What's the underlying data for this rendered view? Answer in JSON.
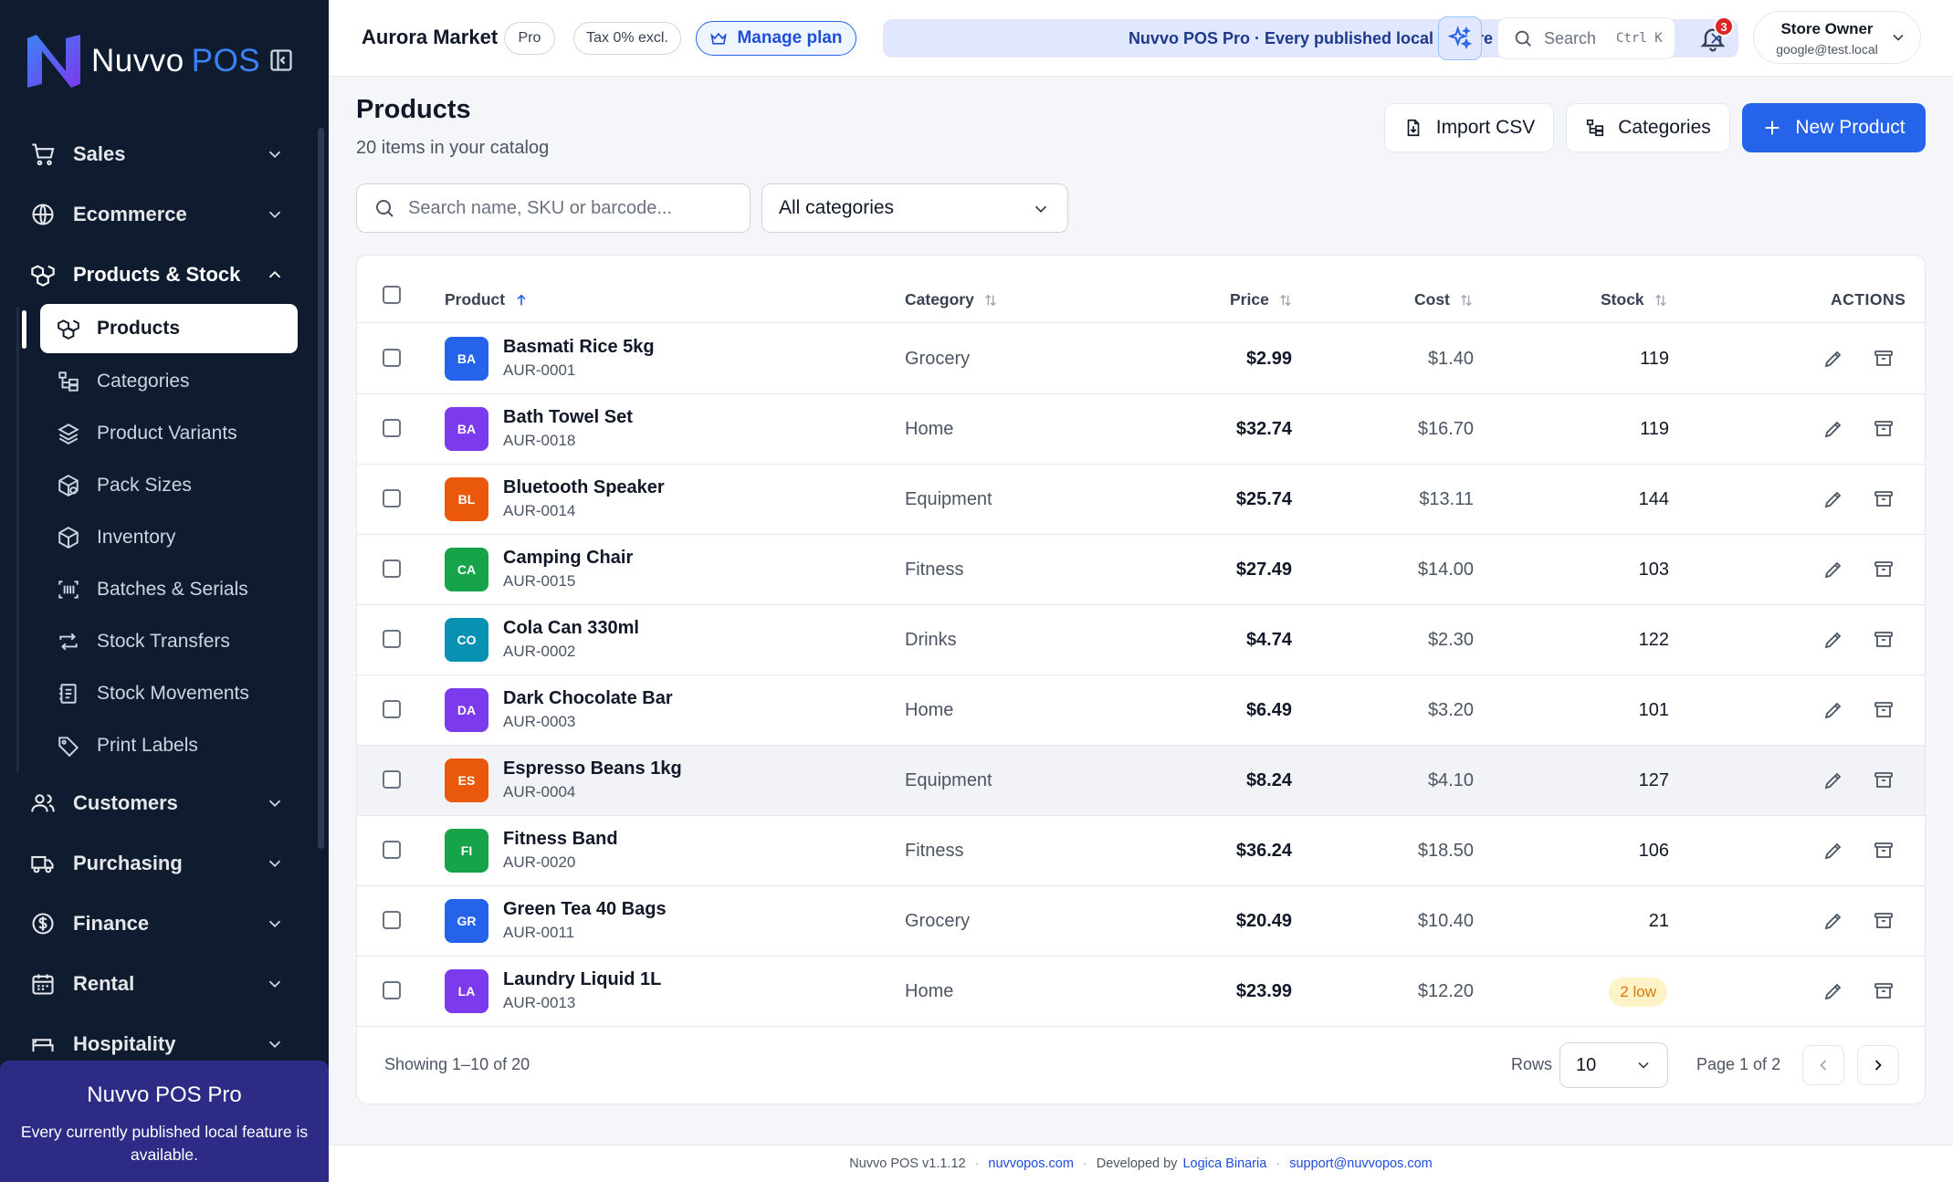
{
  "brand": {
    "name": "Nuvvo",
    "suffix": "POS"
  },
  "sidebar": {
    "groups": [
      {
        "label": "Sales",
        "icon": "cart-icon"
      },
      {
        "label": "Ecommerce",
        "icon": "globe-icon"
      },
      {
        "label": "Products & Stock",
        "icon": "boxes-icon",
        "expanded": true
      },
      {
        "label": "Customers",
        "icon": "users-icon"
      },
      {
        "label": "Purchasing",
        "icon": "truck-icon"
      },
      {
        "label": "Finance",
        "icon": "dollar-circle-icon"
      },
      {
        "label": "Rental",
        "icon": "calendar-icon"
      },
      {
        "label": "Hospitality",
        "icon": "bed-icon"
      }
    ],
    "sub_items": [
      {
        "label": "Products",
        "icon": "boxes-icon",
        "active": true
      },
      {
        "label": "Categories",
        "icon": "tree-icon"
      },
      {
        "label": "Product Variants",
        "icon": "layers-icon"
      },
      {
        "label": "Pack Sizes",
        "icon": "package-icon"
      },
      {
        "label": "Inventory",
        "icon": "box-icon"
      },
      {
        "label": "Batches & Serials",
        "icon": "barcode-scan-icon"
      },
      {
        "label": "Stock Transfers",
        "icon": "transfer-icon"
      },
      {
        "label": "Stock Movements",
        "icon": "ledger-icon"
      },
      {
        "label": "Print Labels",
        "icon": "tag-icon"
      }
    ],
    "promo": {
      "title": "Nuvvo POS Pro",
      "text": "Every currently published local feature is available."
    }
  },
  "topbar": {
    "store_name": "Aurora Market",
    "plan_badge": "Pro",
    "tax_badge": "Tax 0% excl.",
    "manage_plan": "Manage plan",
    "banner": "Nuvvo POS Pro · Every published local feature",
    "search_label": "Search",
    "search_shortcut": "Ctrl K",
    "notification_count": "3",
    "user_name": "Store Owner",
    "user_email": "google@test.local"
  },
  "page": {
    "title": "Products",
    "subtitle": "20 items in your catalog",
    "import_csv": "Import CSV",
    "categories": "Categories",
    "new_product": "New Product",
    "search_placeholder": "Search name, SKU or barcode...",
    "category_filter": "All categories"
  },
  "table": {
    "columns": {
      "product": "Product",
      "category": "Category",
      "price": "Price",
      "cost": "Cost",
      "stock": "Stock",
      "actions": "ACTIONS"
    },
    "rows": [
      {
        "initials": "BA",
        "color": "#2563eb",
        "name": "Basmati Rice 5kg",
        "sku": "AUR-0001",
        "category": "Grocery",
        "price": "$2.99",
        "cost": "$1.40",
        "stock": "119"
      },
      {
        "initials": "BA",
        "color": "#7c3aed",
        "name": "Bath Towel Set",
        "sku": "AUR-0018",
        "category": "Home",
        "price": "$32.74",
        "cost": "$16.70",
        "stock": "119"
      },
      {
        "initials": "BL",
        "color": "#ea580c",
        "name": "Bluetooth Speaker",
        "sku": "AUR-0014",
        "category": "Equipment",
        "price": "$25.74",
        "cost": "$13.11",
        "stock": "144"
      },
      {
        "initials": "CA",
        "color": "#16a34a",
        "name": "Camping Chair",
        "sku": "AUR-0015",
        "category": "Fitness",
        "price": "$27.49",
        "cost": "$14.00",
        "stock": "103"
      },
      {
        "initials": "CO",
        "color": "#0891b2",
        "name": "Cola Can 330ml",
        "sku": "AUR-0002",
        "category": "Drinks",
        "price": "$4.74",
        "cost": "$2.30",
        "stock": "122"
      },
      {
        "initials": "DA",
        "color": "#7c3aed",
        "name": "Dark Chocolate Bar",
        "sku": "AUR-0003",
        "category": "Home",
        "price": "$6.49",
        "cost": "$3.20",
        "stock": "101"
      },
      {
        "initials": "ES",
        "color": "#ea580c",
        "name": "Espresso Beans 1kg",
        "sku": "AUR-0004",
        "category": "Equipment",
        "price": "$8.24",
        "cost": "$4.10",
        "stock": "127"
      },
      {
        "initials": "FI",
        "color": "#16a34a",
        "name": "Fitness Band",
        "sku": "AUR-0020",
        "category": "Fitness",
        "price": "$36.24",
        "cost": "$18.50",
        "stock": "106"
      },
      {
        "initials": "GR",
        "color": "#2563eb",
        "name": "Green Tea 40 Bags",
        "sku": "AUR-0011",
        "category": "Grocery",
        "price": "$20.49",
        "cost": "$10.40",
        "stock": "21"
      },
      {
        "initials": "LA",
        "color": "#7c3aed",
        "name": "Laundry Liquid 1L",
        "sku": "AUR-0013",
        "category": "Home",
        "price": "$23.99",
        "cost": "$12.20",
        "stock": "2 low",
        "low": true
      }
    ],
    "showing": "Showing 1–10 of 20",
    "rows_label": "Rows",
    "rows_value": "10",
    "page_info": "Page 1 of 2"
  },
  "footer": {
    "version": "Nuvvo POS v1.1.12",
    "site": "nuvvopos.com",
    "developed_by": "Developed by",
    "developer": "Logica Binaria",
    "support": "support@nuvvopos.com"
  },
  "colors": {
    "sidebar_bg": "#0f1b2e",
    "accent": "#2563eb",
    "promo_bg": "#2e2b86",
    "low_stock": "#d97706"
  }
}
